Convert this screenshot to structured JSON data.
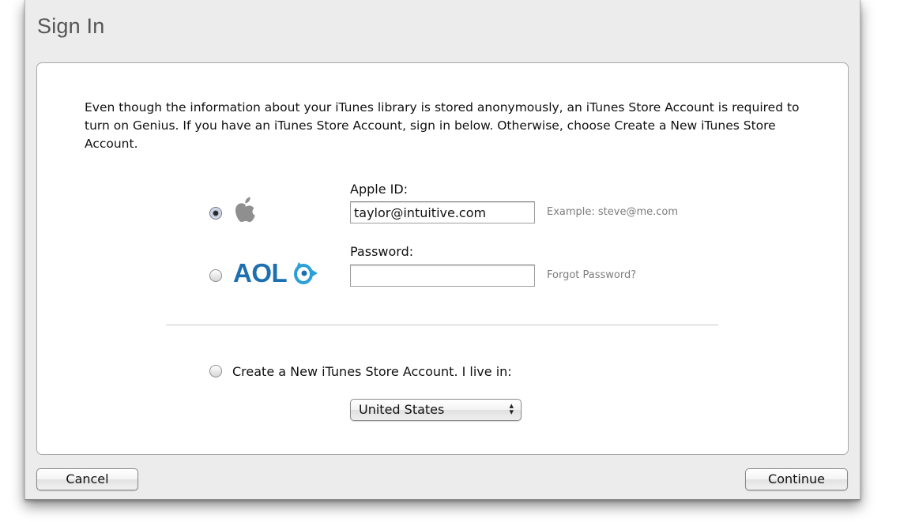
{
  "window": {
    "title": "Sign In"
  },
  "intro_text": "Even though the information about your iTunes library is stored anonymously, an iTunes Store Account is required to turn on Genius. If you have an iTunes Store Account, sign in below. Otherwise, choose Create a New iTunes Store Account.",
  "account_options": [
    {
      "provider": "Apple",
      "icon": "apple-logo-icon",
      "selected": true
    },
    {
      "provider": "AOL",
      "icon": "aol-logo-icon",
      "logo_text": "AOL",
      "selected": false
    }
  ],
  "apple_id": {
    "label": "Apple ID:",
    "value": "taylor@intuitive.com",
    "hint": "Example: steve@me.com"
  },
  "password": {
    "label": "Password:",
    "value": "",
    "link": "Forgot Password?"
  },
  "create_account": {
    "label": "Create a New iTunes Store Account. I live in:",
    "selected": false,
    "country": "United States"
  },
  "buttons": {
    "cancel": "Cancel",
    "continue": "Continue"
  },
  "colors": {
    "aol_blue": "#1d6fb0",
    "window_bg": "#ececec",
    "panel_bg": "#ffffff"
  }
}
